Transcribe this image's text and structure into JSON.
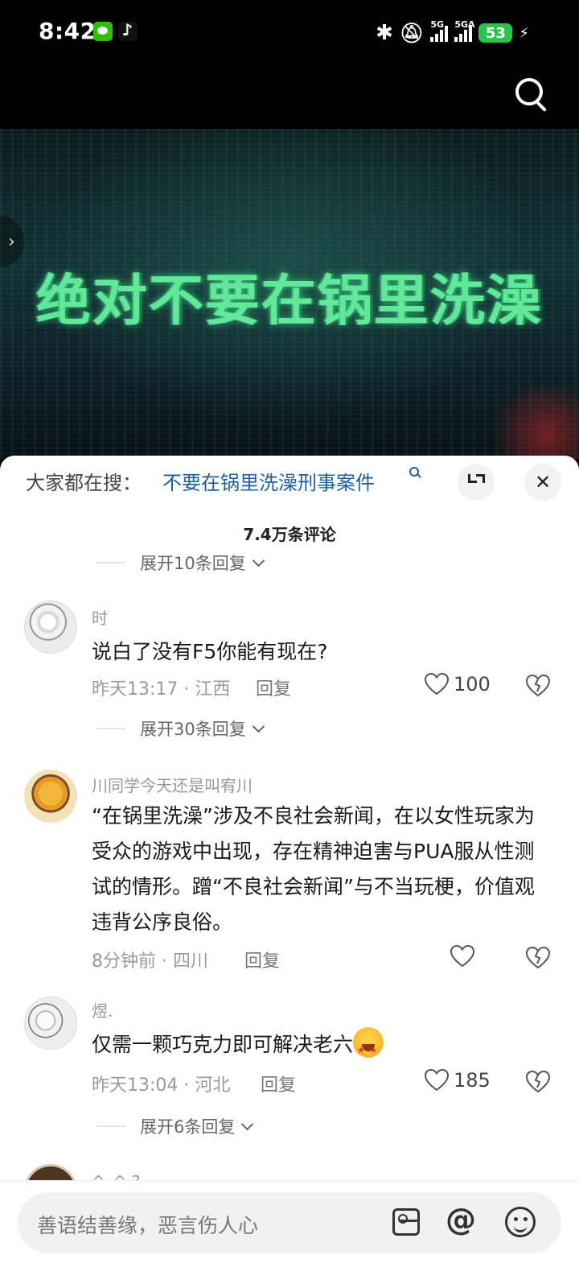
{
  "status_bar": {
    "time": "8:42",
    "network_1": "5G",
    "network_2": "5GA",
    "battery": "53",
    "icons": [
      "wechat-icon",
      "tiktok-icon",
      "bluetooth-icon",
      "mute-icon",
      "signal-icon",
      "battery-icon",
      "charging-icon"
    ]
  },
  "video": {
    "title": "绝对不要在锅里洗澡"
  },
  "sheet": {
    "hot_search_prefix": "大家都在搜：",
    "hot_search_query": "不要在锅里洗澡刑事案件",
    "comment_count": "7.4万条评论"
  },
  "expand_replies": [
    {
      "label": "展开10条回复"
    },
    {
      "label": "展开30条回复"
    },
    {
      "label": "展开6条回复"
    }
  ],
  "comments": [
    {
      "user": "时",
      "text": "说白了没有F5你能有现在?",
      "meta": "昨天13:17 · 江西",
      "reply": "回复",
      "likes": "100"
    },
    {
      "user": "川同学今天还是叫宥川",
      "text": "“在锅里洗澡”涉及不良社会新闻，在以女性玩家为受众的游戏中出现，存在精神迫害与PUA服从性测试的情形。蹭“不良社会新闻”与不当玩梗，价值观违背公序良俗。",
      "meta": "8分钟前 · 四川",
      "reply": "回复",
      "likes": ""
    },
    {
      "user": "煜.",
      "text": "仅需一颗巧克力即可解决老六",
      "meta": "昨天13:04 · 河北",
      "reply": "回复",
      "likes": "185"
    },
    {
      "user": "^_^ ?"
    }
  ],
  "input": {
    "placeholder": "善语结善缘，恶言伤人心"
  },
  "colors": {
    "accent_link": "#1f5f9e",
    "video_title": "#63e79a",
    "battery": "#27c64a"
  }
}
